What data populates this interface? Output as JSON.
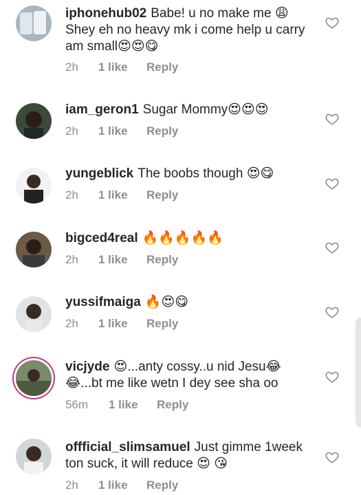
{
  "comments": [
    {
      "user": "iphonehub02",
      "text": "Babe! u no make me 😩 Shey eh no heavy mk i come help u carry am small😍😍😋",
      "time": "2h",
      "likes": "1 like",
      "reply": "Reply"
    },
    {
      "user": "iam_geron1",
      "text": "Sugar Mommy😍😍😍",
      "time": "2h",
      "likes": "1 like",
      "reply": "Reply"
    },
    {
      "user": "yungeblick",
      "text": "The boobs though 😍😋",
      "time": "2h",
      "likes": "1 like",
      "reply": "Reply"
    },
    {
      "user": "bigced4real",
      "text": "🔥🔥🔥🔥🔥",
      "time": "2h",
      "likes": "1 like",
      "reply": "Reply"
    },
    {
      "user": "yussifmaiga",
      "text": "🔥😍😋",
      "time": "2h",
      "likes": "1 like",
      "reply": "Reply"
    },
    {
      "user": "vicjyde",
      "text": "😍...anty cossy..u nid Jesu😂 😂...bt me like wetn I dey see sha oo",
      "time": "56m",
      "likes": "1 like",
      "reply": "Reply"
    },
    {
      "user": "offficial_slimsamuel",
      "text": "Just gimme 1week ton suck, it will reduce 😍 😘",
      "time": "2h",
      "likes": "1 like",
      "reply": "Reply"
    }
  ],
  "icons": {
    "like": "heart-outline-icon"
  },
  "colors": {
    "meta": "#8e8e8e",
    "text": "#262626",
    "story_ring": "#c13584"
  }
}
